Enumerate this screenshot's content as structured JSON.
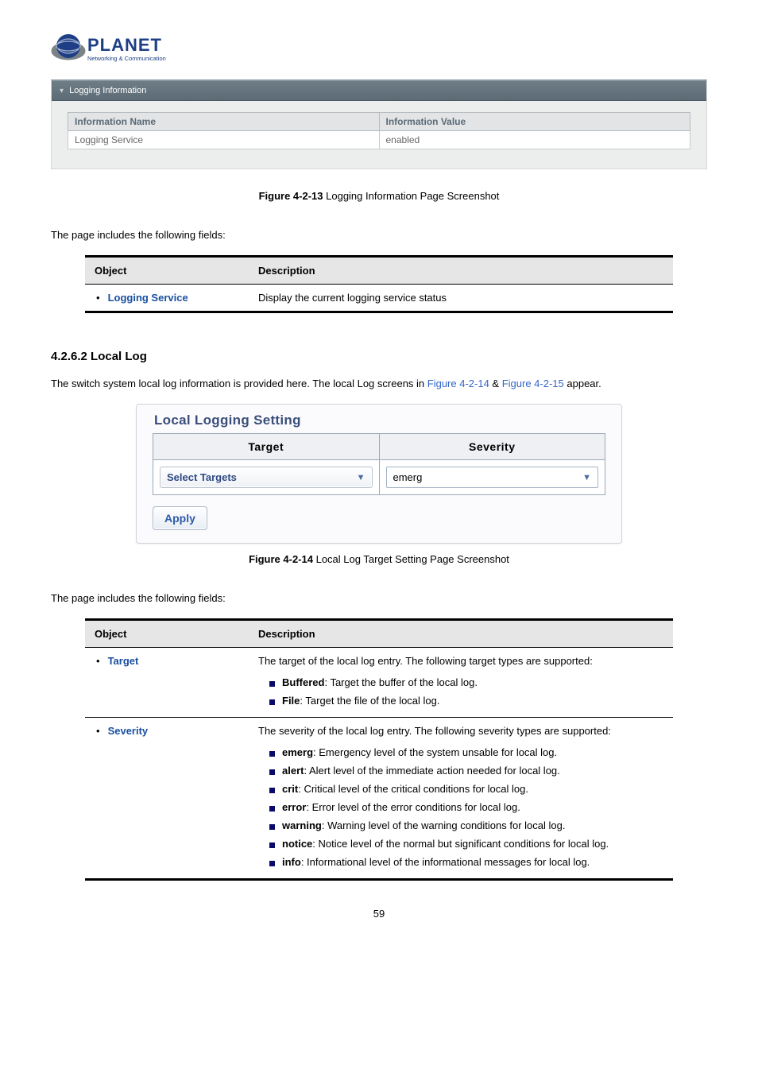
{
  "logo": {
    "word": "PLANET",
    "sub": "Networking & Communication"
  },
  "loggingInfoPanel": {
    "titlebar": "Logging Information",
    "headers": [
      "Information Name",
      "Information Value"
    ],
    "row": {
      "name": "Logging Service",
      "value": "enabled"
    }
  },
  "fig13": {
    "b": "Figure 4-2-13",
    "rest": " Logging Information Page Screenshot"
  },
  "includesText": "The page includes the following fields:",
  "objTable1": {
    "headers": [
      "Object",
      "Description"
    ],
    "rows": [
      {
        "obj": "Logging Service",
        "desc": "Display the current logging service status"
      }
    ]
  },
  "sectionHeading": "4.2.6.2 Local Log",
  "localLogIntro_pre": "The switch system local log information is provided here. The local Log screens in ",
  "localLogIntro_link1": "Figure 4-2-14",
  "localLogIntro_mid": " & ",
  "localLogIntro_link2": "Figure 4-2-15",
  "localLogIntro_post": " appear.",
  "llBox": {
    "title": "Local Logging Setting",
    "headers": [
      "Target",
      "Severity"
    ],
    "targetSelected": "Select Targets",
    "severitySelected": "emerg",
    "apply": "Apply"
  },
  "fig14": {
    "b": "Figure 4-2-14",
    "rest": " Local Log Target Setting Page Screenshot"
  },
  "objTable2": {
    "headers": [
      "Object",
      "Description"
    ],
    "targetRow": {
      "obj": "Target",
      "lead": "The target of the local log entry. The following target types are supported:",
      "items": [
        {
          "term": "Buffered",
          "rest": ": Target the buffer of the local log."
        },
        {
          "term": "File",
          "rest": ": Target the file of the local log."
        }
      ]
    },
    "severityRow": {
      "obj": "Severity",
      "lead": "The severity of the local log entry. The following severity types are supported:",
      "items": [
        {
          "term": "emerg",
          "rest": ": Emergency level of the system unsable for local log."
        },
        {
          "term": "alert",
          "rest": ": Alert level of the immediate action needed for local log."
        },
        {
          "term": "crit",
          "rest": ": Critical level of the critical conditions for local log."
        },
        {
          "term": "error",
          "rest": ": Error level of the error conditions for local log."
        },
        {
          "term": "warning",
          "rest": ": Warning level of the warning conditions for local log."
        },
        {
          "term": "notice",
          "rest": ": Notice level of the normal but significant conditions for local log."
        },
        {
          "term": "info",
          "rest": ": Informational level of the informational messages for local log."
        }
      ]
    }
  },
  "pageNumber": "59"
}
